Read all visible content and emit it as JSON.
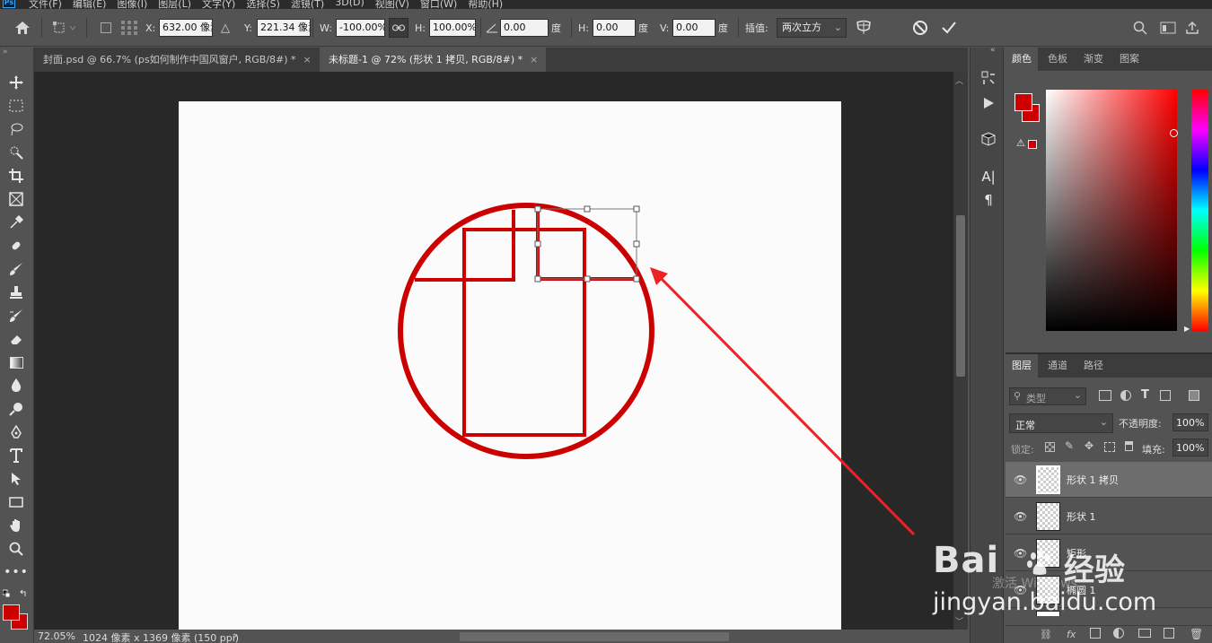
{
  "app": {
    "logo": "Ps"
  },
  "menu": [
    "文件(F)",
    "编辑(E)",
    "图像(I)",
    "图层(L)",
    "文字(Y)",
    "选择(S)",
    "滤镜(T)",
    "3D(D)",
    "视图(V)",
    "窗口(W)",
    "帮助(H)"
  ],
  "options": {
    "x_label": "X:",
    "x_value": "632.00 像素",
    "y_label": "Y:",
    "y_value": "221.34 像素",
    "w_label": "W:",
    "w_value": "-100.00%",
    "h_label": "H:",
    "h_value": "100.00%",
    "angle_value": "0.00",
    "angle_unit": "度",
    "hskew_label": "H:",
    "hskew_value": "0.00",
    "hskew_unit": "度",
    "vskew_label": "V:",
    "vskew_value": "0.00",
    "vskew_unit": "度",
    "interp_label": "插值:",
    "interp_value": "两次立方"
  },
  "tabs": [
    {
      "label": "封面.psd @ 66.7% (ps如何制作中国风窗户, RGB/8#) *",
      "close": "×"
    },
    {
      "label": "未标题-1 @ 72% (形状 1 拷贝, RGB/8#) *",
      "close": "×"
    }
  ],
  "status": {
    "zoom": "72.05%",
    "doc_size": "1024 像素 x 1369 像素 (150 ppi)",
    "arrow": "›"
  },
  "color_panel": {
    "tabs": [
      "颜色",
      "色板",
      "渐变",
      "图案"
    ],
    "fg": "#cc0000",
    "bg": "#cc0000"
  },
  "layers_panel": {
    "tabs": [
      "图层",
      "通道",
      "路径"
    ],
    "search_placeholder": "类型",
    "blend_mode": "正常",
    "opacity_label": "不透明度:",
    "opacity_value": "100%",
    "lock_label": "锁定:",
    "fill_label": "填充:",
    "fill_value": "100%",
    "layers": [
      {
        "name": "形状 1 拷贝",
        "selected": true
      },
      {
        "name": "形状 1",
        "selected": false
      },
      {
        "name": "矩形",
        "selected": false
      },
      {
        "name": "椭圆 1",
        "selected": false
      }
    ]
  },
  "canvas": {
    "stroke_color": "#cc0000",
    "arrow_color": "#ee2222"
  },
  "watermark": {
    "brand": "Bai",
    "brand_cn": "经验",
    "site": "jingyan.baidu.com",
    "overlay": "激活 Windows"
  }
}
